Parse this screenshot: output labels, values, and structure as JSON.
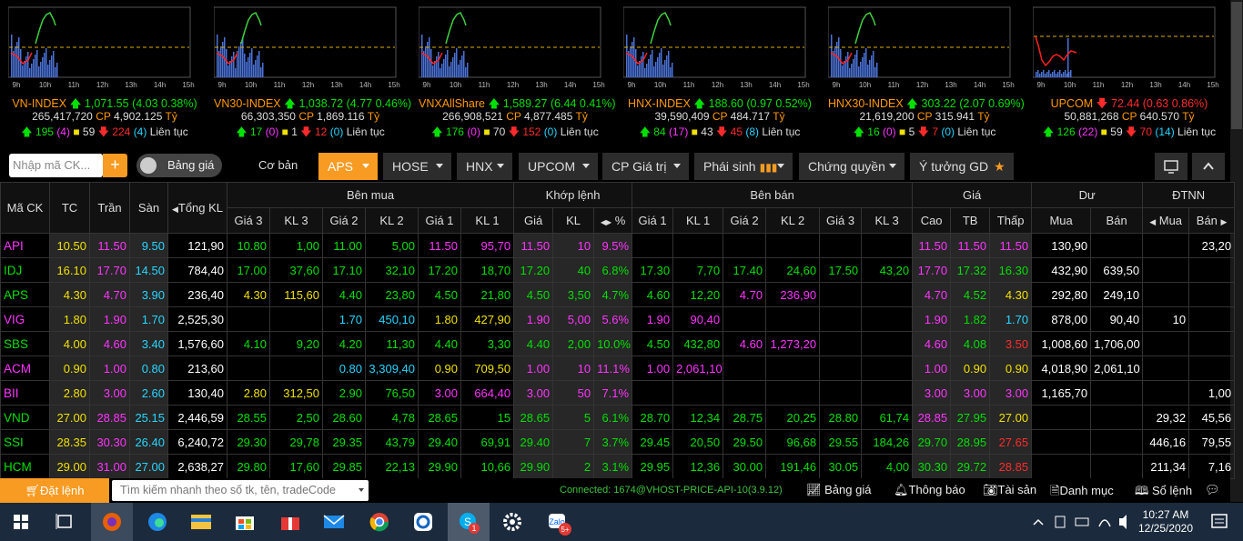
{
  "time_axis": [
    "9h",
    "10h",
    "11h",
    "12h",
    "13h",
    "14h",
    "15h"
  ],
  "indices": [
    {
      "name": "VN-INDEX",
      "dir": "up",
      "value": "1,071.55",
      "change": "(4.03 0.38%)",
      "volume": "265,417,720",
      "cp_label": "CP",
      "cp": "4,902.125",
      "unit": "Tỷ",
      "up": "195",
      "up_ceil": "(4)",
      "flat": "59",
      "down": "224",
      "down_floor": "(4)",
      "status": "Liên tục"
    },
    {
      "name": "VN30-INDEX",
      "dir": "up",
      "value": "1,038.72",
      "change": "(4.77 0.46%)",
      "volume": "66,303,350",
      "cp_label": "CP",
      "cp": "1,869.116",
      "unit": "Tỷ",
      "up": "17",
      "up_ceil": "(0)",
      "flat": "1",
      "down": "12",
      "down_floor": "(0)",
      "status": "Liên tục"
    },
    {
      "name": "VNXAllShare",
      "dir": "up",
      "value": "1,589.27",
      "change": "(6.44 0.41%)",
      "volume": "266,908,521",
      "cp_label": "CP",
      "cp": "4,877.485",
      "unit": "Tỷ",
      "up": "176",
      "up_ceil": "(0)",
      "flat": "70",
      "down": "152",
      "down_floor": "(0)",
      "status": "Liên tục"
    },
    {
      "name": "HNX-INDEX",
      "dir": "up",
      "value": "188.60",
      "change": "(0.97 0.52%)",
      "volume": "39,590,409",
      "cp_label": "CP",
      "cp": "484.717",
      "unit": "Tỷ",
      "up": "84",
      "up_ceil": "(17)",
      "flat": "43",
      "down": "45",
      "down_floor": "(8)",
      "status": "Liên tục"
    },
    {
      "name": "HNX30-INDEX",
      "dir": "up",
      "value": "303.22",
      "change": "(2.07 0.69%)",
      "volume": "21,619,200",
      "cp_label": "CP",
      "cp": "315.941",
      "unit": "Tỷ",
      "up": "16",
      "up_ceil": "(0)",
      "flat": "5",
      "down": "7",
      "down_floor": "(0)",
      "status": "Liên tục"
    },
    {
      "name": "UPCOM",
      "dir": "down",
      "value": "72.44",
      "change": "(0.63 0.86%)",
      "volume": "50,881,268",
      "cp_label": "CP",
      "cp": "640.570",
      "unit": "Tỷ",
      "up": "126",
      "up_ceil": "(22)",
      "flat": "59",
      "down": "70",
      "down_floor": "(14)",
      "status": "Liên tục"
    }
  ],
  "toolbar": {
    "search_placeholder": "Nhập mã CK...",
    "plus": "+",
    "toggle_label": "Bảng giá",
    "basic_label": "Cơ bản",
    "tabs": [
      "APS",
      "HOSE",
      "HNX",
      "UPCOM",
      "CP Giá trị",
      "Phái sinh",
      "Chứng quyền",
      "Ý tưởng GD"
    ]
  },
  "headers": {
    "symbol": "Mã CK",
    "ref": "TC",
    "ceil": "Trần",
    "floor": "Sàn",
    "total": "Tổng KL",
    "buy": "Bên mua",
    "match": "Khớp lệnh",
    "sell": "Bên bán",
    "price": "Giá",
    "residual": "Dư",
    "foreign": "ĐTNN",
    "p3": "Giá 3",
    "v3": "KL 3",
    "p2": "Giá 2",
    "v2": "KL 2",
    "p1": "Giá 1",
    "v1": "KL 1",
    "mp": "Giá",
    "mv": "KL",
    "pct": "%",
    "sp1": "Giá 1",
    "sv1": "KL 1",
    "sp2": "Giá 2",
    "sv2": "KL 2",
    "sp3": "Giá 3",
    "sv3": "KL 3",
    "high": "Cao",
    "avg": "TB",
    "low": "Thấp",
    "rbuy": "Mua",
    "rsell": "Bán",
    "fbuy": "Mua",
    "fsell": "Bán"
  },
  "rows": [
    {
      "s": "API",
      "sc": "m",
      "tc": "10.50",
      "tr": "11.50",
      "sa": "9.50",
      "kl": "121,90",
      "b": [
        [
          "10.80",
          "g"
        ],
        [
          "1,00",
          "g"
        ],
        [
          "11.00",
          "g"
        ],
        [
          "5,00",
          "g"
        ],
        [
          "11.50",
          "m"
        ],
        [
          "95,70",
          "m"
        ]
      ],
      "m": [
        [
          "11.50",
          "m"
        ],
        [
          "10",
          "m"
        ],
        [
          "9.5%",
          "m"
        ]
      ],
      "a": [
        [
          "",
          ""
        ],
        [
          "",
          ""
        ],
        [
          "",
          ""
        ],
        [
          "",
          ""
        ],
        [
          "",
          ""
        ],
        [
          "",
          ""
        ]
      ],
      "p": [
        [
          "11.50",
          "m"
        ],
        [
          "11.50",
          "m"
        ],
        [
          "11.50",
          "m"
        ]
      ],
      "du": [
        "130,90",
        ""
      ],
      "nn": [
        "",
        "23,20"
      ]
    },
    {
      "s": "IDJ",
      "sc": "g",
      "tc": "16.10",
      "tr": "17.70",
      "sa": "14.50",
      "kl": "784,40",
      "b": [
        [
          "17.00",
          "g"
        ],
        [
          "37,60",
          "g"
        ],
        [
          "17.10",
          "g"
        ],
        [
          "32,10",
          "g"
        ],
        [
          "17.20",
          "g"
        ],
        [
          "18,70",
          "g"
        ]
      ],
      "m": [
        [
          "17.20",
          "g"
        ],
        [
          "40",
          "g"
        ],
        [
          "6.8%",
          "g"
        ]
      ],
      "a": [
        [
          "17.30",
          "g"
        ],
        [
          "7,70",
          "g"
        ],
        [
          "17.40",
          "g"
        ],
        [
          "24,60",
          "g"
        ],
        [
          "17.50",
          "g"
        ],
        [
          "43,20",
          "g"
        ]
      ],
      "p": [
        [
          "17.70",
          "m"
        ],
        [
          "17.32",
          "g"
        ],
        [
          "16.30",
          "g"
        ]
      ],
      "du": [
        "432,90",
        "639,50"
      ],
      "nn": [
        "",
        ""
      ]
    },
    {
      "s": "APS",
      "sc": "g",
      "tc": "4.30",
      "tr": "4.70",
      "sa": "3.90",
      "kl": "236,40",
      "b": [
        [
          "4.30",
          "y"
        ],
        [
          "115,60",
          "y"
        ],
        [
          "4.40",
          "g"
        ],
        [
          "23,80",
          "g"
        ],
        [
          "4.50",
          "g"
        ],
        [
          "21,80",
          "g"
        ]
      ],
      "m": [
        [
          "4.50",
          "g"
        ],
        [
          "3,50",
          "g"
        ],
        [
          "4.7%",
          "g"
        ]
      ],
      "a": [
        [
          "4.60",
          "g"
        ],
        [
          "12,20",
          "g"
        ],
        [
          "4.70",
          "m"
        ],
        [
          "236,90",
          "m"
        ],
        [
          "",
          ""
        ],
        [
          "",
          ""
        ]
      ],
      "p": [
        [
          "4.70",
          "m"
        ],
        [
          "4.52",
          "g"
        ],
        [
          "4.30",
          "y"
        ]
      ],
      "du": [
        "292,80",
        "249,10"
      ],
      "nn": [
        "",
        ""
      ]
    },
    {
      "s": "VIG",
      "sc": "m",
      "tc": "1.80",
      "tr": "1.90",
      "sa": "1.70",
      "kl": "2,525,30",
      "b": [
        [
          "",
          ""
        ],
        [
          "",
          ""
        ],
        [
          "1.70",
          "c"
        ],
        [
          "450,10",
          "c"
        ],
        [
          "1.80",
          "y"
        ],
        [
          "427,90",
          "y"
        ]
      ],
      "m": [
        [
          "1.90",
          "m"
        ],
        [
          "5,00",
          "m"
        ],
        [
          "5.6%",
          "m"
        ]
      ],
      "a": [
        [
          "1.90",
          "m"
        ],
        [
          "90,40",
          "m"
        ],
        [
          "",
          ""
        ],
        [
          "",
          ""
        ],
        [
          "",
          ""
        ],
        [
          "",
          ""
        ]
      ],
      "p": [
        [
          "1.90",
          "m"
        ],
        [
          "1.82",
          "g"
        ],
        [
          "1.70",
          "c"
        ]
      ],
      "du": [
        "878,00",
        "90,40"
      ],
      "nn": [
        "10",
        ""
      ]
    },
    {
      "s": "SBS",
      "sc": "g",
      "tc": "4.00",
      "tr": "4.60",
      "sa": "3.40",
      "kl": "1,576,60",
      "b": [
        [
          "4.10",
          "g"
        ],
        [
          "9,20",
          "g"
        ],
        [
          "4.20",
          "g"
        ],
        [
          "11,30",
          "g"
        ],
        [
          "4.40",
          "g"
        ],
        [
          "3,30",
          "g"
        ]
      ],
      "m": [
        [
          "4.40",
          "g"
        ],
        [
          "2,00",
          "g"
        ],
        [
          "10.0%",
          "g"
        ]
      ],
      "a": [
        [
          "4.50",
          "g"
        ],
        [
          "432,80",
          "g"
        ],
        [
          "4.60",
          "m"
        ],
        [
          "1,273,20",
          "m"
        ],
        [
          "",
          ""
        ],
        [
          "",
          ""
        ]
      ],
      "p": [
        [
          "4.60",
          "m"
        ],
        [
          "4.08",
          "g"
        ],
        [
          "3.50",
          "r"
        ]
      ],
      "du": [
        "1,008,60",
        "1,706,00"
      ],
      "nn": [
        "",
        ""
      ]
    },
    {
      "s": "ACM",
      "sc": "m",
      "tc": "0.90",
      "tr": "1.00",
      "sa": "0.80",
      "kl": "213,60",
      "b": [
        [
          "",
          ""
        ],
        [
          "",
          ""
        ],
        [
          "0.80",
          "c"
        ],
        [
          "3,309,40",
          "c"
        ],
        [
          "0.90",
          "y"
        ],
        [
          "709,50",
          "y"
        ]
      ],
      "m": [
        [
          "1.00",
          "m"
        ],
        [
          "10",
          "m"
        ],
        [
          "11.1%",
          "m"
        ]
      ],
      "a": [
        [
          "1.00",
          "m"
        ],
        [
          "2,061,10",
          "m"
        ],
        [
          "",
          ""
        ],
        [
          "",
          ""
        ],
        [
          "",
          ""
        ],
        [
          "",
          ""
        ]
      ],
      "p": [
        [
          "1.00",
          "m"
        ],
        [
          "0.90",
          "y"
        ],
        [
          "0.90",
          "y"
        ]
      ],
      "du": [
        "4,018,90",
        "2,061,10"
      ],
      "nn": [
        "",
        ""
      ]
    },
    {
      "s": "BII",
      "sc": "m",
      "tc": "2.80",
      "tr": "3.00",
      "sa": "2.60",
      "kl": "130,40",
      "b": [
        [
          "2.80",
          "y"
        ],
        [
          "312,50",
          "y"
        ],
        [
          "2.90",
          "g"
        ],
        [
          "76,50",
          "g"
        ],
        [
          "3.00",
          "m"
        ],
        [
          "664,40",
          "m"
        ]
      ],
      "m": [
        [
          "3.00",
          "m"
        ],
        [
          "50",
          "m"
        ],
        [
          "7.1%",
          "m"
        ]
      ],
      "a": [
        [
          "",
          ""
        ],
        [
          "",
          ""
        ],
        [
          "",
          ""
        ],
        [
          "",
          ""
        ],
        [
          "",
          ""
        ],
        [
          "",
          ""
        ]
      ],
      "p": [
        [
          "3.00",
          "m"
        ],
        [
          "3.00",
          "m"
        ],
        [
          "3.00",
          "m"
        ]
      ],
      "du": [
        "1,165,70",
        ""
      ],
      "nn": [
        "",
        "1,00"
      ]
    },
    {
      "s": "VND",
      "sc": "g",
      "tc": "27.00",
      "tr": "28.85",
      "sa": "25.15",
      "kl": "2,446,59",
      "b": [
        [
          "28.55",
          "g"
        ],
        [
          "2,50",
          "g"
        ],
        [
          "28.60",
          "g"
        ],
        [
          "4,78",
          "g"
        ],
        [
          "28.65",
          "g"
        ],
        [
          "15",
          "g"
        ]
      ],
      "m": [
        [
          "28.65",
          "g"
        ],
        [
          "5",
          "g"
        ],
        [
          "6.1%",
          "g"
        ]
      ],
      "a": [
        [
          "28.70",
          "g"
        ],
        [
          "12,34",
          "g"
        ],
        [
          "28.75",
          "g"
        ],
        [
          "20,25",
          "g"
        ],
        [
          "28.80",
          "g"
        ],
        [
          "61,74",
          "g"
        ]
      ],
      "p": [
        [
          "28.85",
          "m"
        ],
        [
          "27.95",
          "g"
        ],
        [
          "27.00",
          "y"
        ]
      ],
      "du": [
        "",
        ""
      ],
      "nn": [
        "29,32",
        "45,56"
      ]
    },
    {
      "s": "SSI",
      "sc": "g",
      "tc": "28.35",
      "tr": "30.30",
      "sa": "26.40",
      "kl": "6,240,72",
      "b": [
        [
          "29.30",
          "g"
        ],
        [
          "29,78",
          "g"
        ],
        [
          "29.35",
          "g"
        ],
        [
          "43,79",
          "g"
        ],
        [
          "29.40",
          "g"
        ],
        [
          "69,91",
          "g"
        ]
      ],
      "m": [
        [
          "29.40",
          "g"
        ],
        [
          "7",
          "g"
        ],
        [
          "3.7%",
          "g"
        ]
      ],
      "a": [
        [
          "29.45",
          "g"
        ],
        [
          "20,50",
          "g"
        ],
        [
          "29.50",
          "g"
        ],
        [
          "96,68",
          "g"
        ],
        [
          "29.55",
          "g"
        ],
        [
          "184,26",
          "g"
        ]
      ],
      "p": [
        [
          "29.70",
          "g"
        ],
        [
          "28.95",
          "g"
        ],
        [
          "27.65",
          "r"
        ]
      ],
      "du": [
        "",
        ""
      ],
      "nn": [
        "446,16",
        "79,55"
      ]
    },
    {
      "s": "HCM",
      "sc": "g",
      "tc": "29.00",
      "tr": "31.00",
      "sa": "27.00",
      "kl": "2,638,27",
      "b": [
        [
          "29.80",
          "g"
        ],
        [
          "17,60",
          "g"
        ],
        [
          "29.85",
          "g"
        ],
        [
          "22,13",
          "g"
        ],
        [
          "29.90",
          "g"
        ],
        [
          "10,66",
          "g"
        ]
      ],
      "m": [
        [
          "29.90",
          "g"
        ],
        [
          "2",
          "g"
        ],
        [
          "3.1%",
          "g"
        ]
      ],
      "a": [
        [
          "29.95",
          "g"
        ],
        [
          "12,36",
          "g"
        ],
        [
          "30.00",
          "g"
        ],
        [
          "191,46",
          "g"
        ],
        [
          "30.05",
          "g"
        ],
        [
          "4,00",
          "g"
        ]
      ],
      "p": [
        [
          "30.30",
          "g"
        ],
        [
          "29.72",
          "g"
        ],
        [
          "28.85",
          "r"
        ]
      ],
      "du": [
        "",
        ""
      ],
      "nn": [
        "211,34",
        "7,16"
      ]
    }
  ],
  "bottom": {
    "order": "Đặt lệnh",
    "quick_search": "Tìm kiếm nhanh theo số tk, tên, tradeCode",
    "connection": "Connected: 1674@VHOST-PRICE-API-10(3.9.12)",
    "links": [
      "Bảng giá",
      "Thông báo",
      "Tài sản",
      "Danh mục",
      "Sổ lệnh"
    ]
  },
  "taskbar": {
    "time": "10:27 AM",
    "date": "12/25/2020",
    "badge_skype": "1",
    "badge_zalo": "5+"
  },
  "colors": {
    "accent": "#f89b22",
    "up": "#00e000",
    "down": "#ff2b2b",
    "ref": "#f0e000",
    "floor": "#26d6ff",
    "ceil": "#ff33ff"
  }
}
